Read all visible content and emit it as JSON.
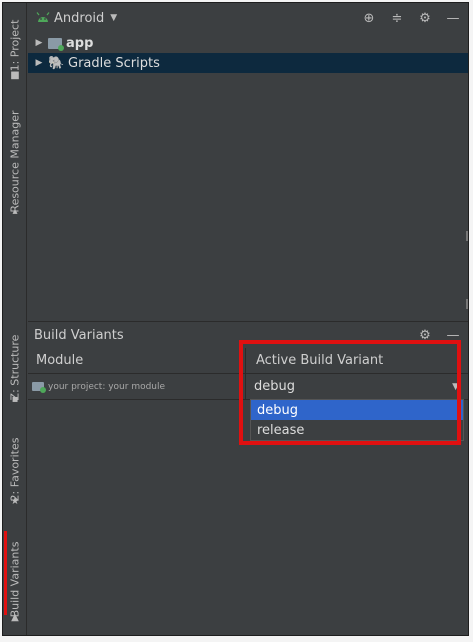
{
  "project_panel": {
    "view_name": "Android",
    "tree": [
      {
        "label": "app",
        "bold": true
      },
      {
        "label": "Gradle Scripts",
        "bold": false
      }
    ]
  },
  "side_tabs": {
    "project": "1: Project",
    "resource_manager": "Resource Manager",
    "structure": "Z: Structure",
    "favorites": "2: Favorites",
    "build_variants": "Build Variants"
  },
  "build_variants": {
    "title": "Build Variants",
    "columns": {
      "module": "Module",
      "variant": "Active Build Variant"
    },
    "row": {
      "module": "your project: your module",
      "variant": "debug"
    },
    "options": [
      "debug",
      "release"
    ],
    "selected_option": "debug"
  },
  "colors": {
    "accent": "#2f65ca",
    "highlight": "#e01010"
  }
}
